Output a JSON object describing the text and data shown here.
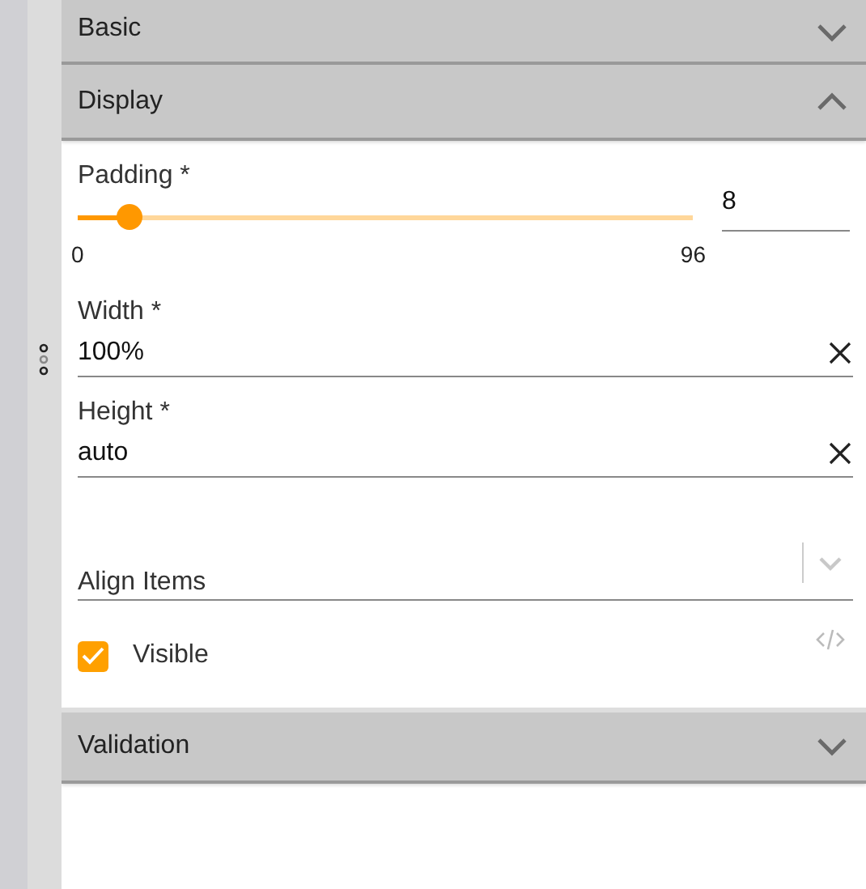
{
  "sections": [
    {
      "title": "Basic",
      "expanded": false
    },
    {
      "title": "Display",
      "expanded": true,
      "fields": [
        {
          "kind": "slider",
          "label": "Padding *",
          "level": 0.083,
          "min": "0",
          "max": "96",
          "value": "8"
        },
        {
          "kind": "text",
          "label": "Width *",
          "value": "100%"
        },
        {
          "kind": "text",
          "label": "Height *",
          "value": "auto"
        },
        {
          "kind": "select",
          "label": "Align Items"
        },
        {
          "kind": "checkbox",
          "label": "Visible",
          "checked": true
        }
      ]
    },
    {
      "title": "Validation",
      "expanded": false
    }
  ]
}
